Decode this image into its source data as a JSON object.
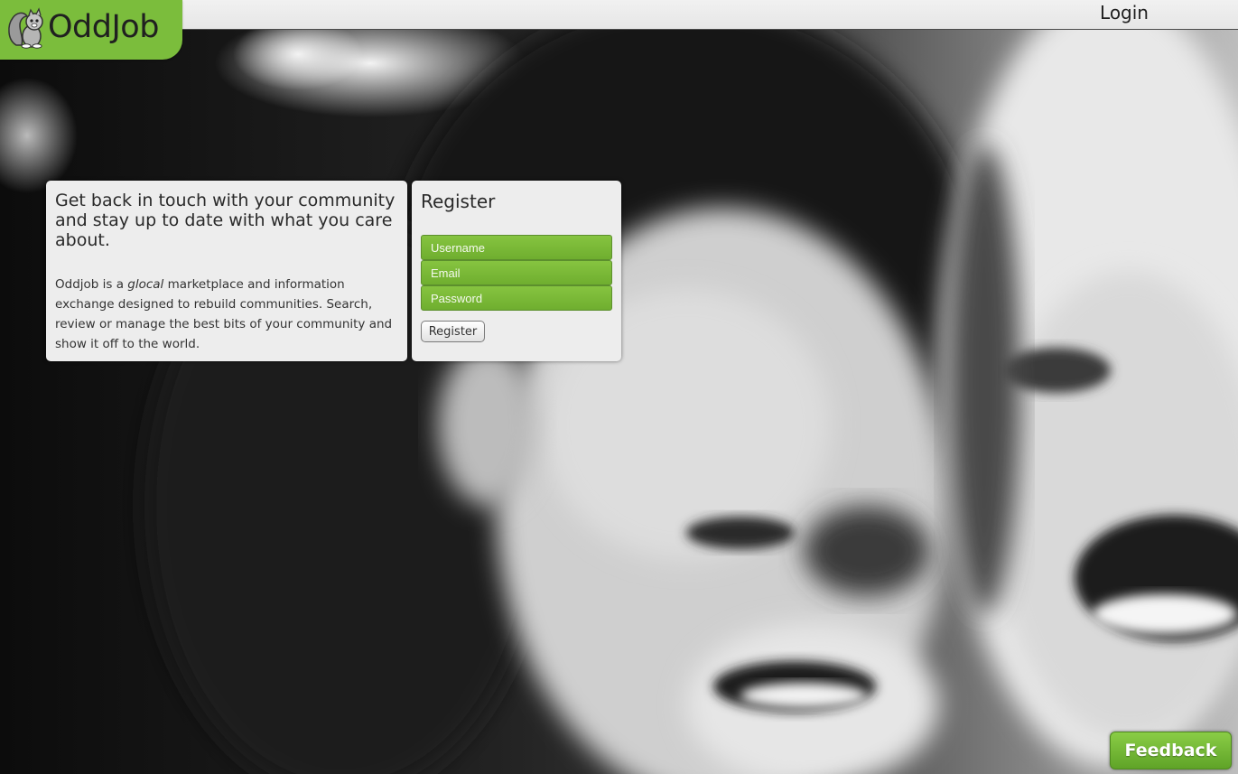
{
  "brand": {
    "name": "OddJob",
    "icon": "squirrel-logo-icon",
    "accent_color": "#7bbd3c"
  },
  "header": {
    "login_label": "Login"
  },
  "intro": {
    "heading": "Get back in touch with your community and stay up to date with what you care about.",
    "body_before": "Oddjob is a ",
    "body_emphasis": "glocal",
    "body_after": " marketplace and information exchange designed to rebuild communities. Search, review or manage the best bits of your community and show it off to the world."
  },
  "register": {
    "title": "Register",
    "username_placeholder": "Username",
    "email_placeholder": "Email",
    "password_placeholder": "Password",
    "submit_label": "Register"
  },
  "feedback": {
    "label": "Feedback"
  }
}
